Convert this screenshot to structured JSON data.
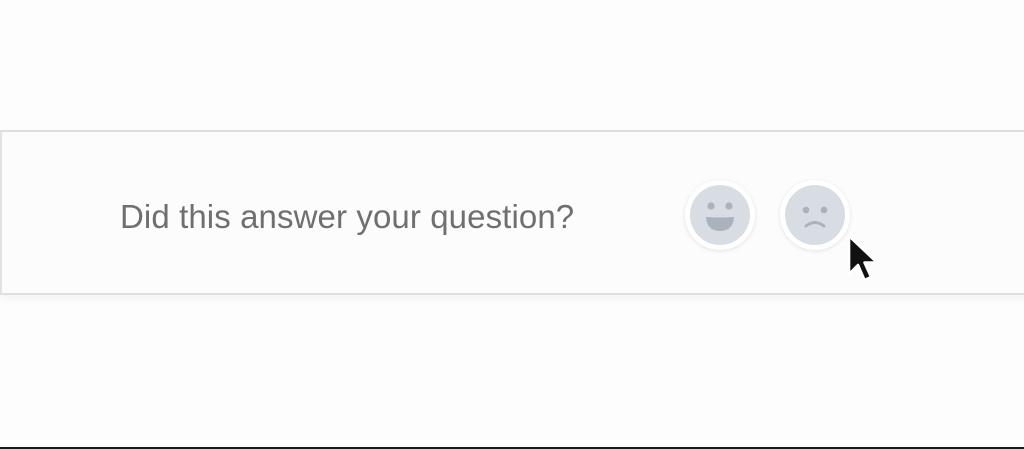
{
  "feedback": {
    "question": "Did this answer your question?",
    "reactions": [
      {
        "icon": "happy-face-icon",
        "sentiment": "positive"
      },
      {
        "icon": "sad-face-icon",
        "sentiment": "negative"
      }
    ]
  },
  "colors": {
    "question_text": "#6f6f6f",
    "emoji_fill": "#d8dde3",
    "emoji_features": "#a9b2bd",
    "divider": "#dedcdc"
  },
  "cursor": {
    "icon": "arrow-cursor-icon"
  }
}
